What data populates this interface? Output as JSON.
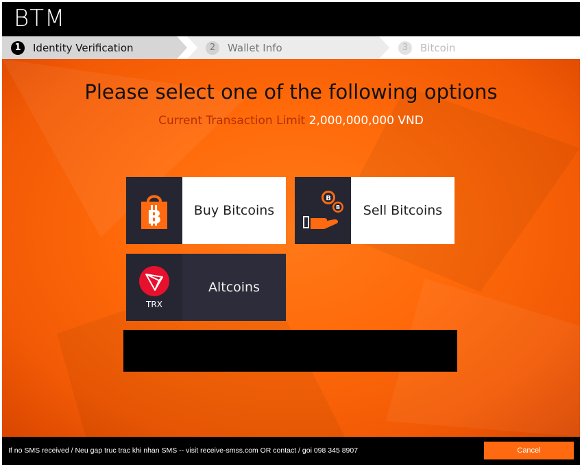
{
  "app": {
    "title": "BTM"
  },
  "steps": [
    {
      "number": "1",
      "label": "Identity Verification",
      "state": "active"
    },
    {
      "number": "2",
      "label": "Wallet Info",
      "state": "pending"
    },
    {
      "number": "3",
      "label": "Bitcoin",
      "state": "pending"
    }
  ],
  "main": {
    "heading": "Please select one of the following options",
    "limit_label": "Current Transaction Limit",
    "limit_value": "2,000,000,000 VND"
  },
  "options": {
    "buy": {
      "label": "Buy Bitcoins",
      "icon": "shopping-bag-bitcoin-icon"
    },
    "sell": {
      "label": "Sell Bitcoins",
      "icon": "hand-coins-icon"
    },
    "altcoins": {
      "label": "Altcoins",
      "icon": "tron-icon",
      "icon_text": "TRX"
    }
  },
  "footer": {
    "note": "If no SMS received / Neu gap truc trac khi nhan SMS -- visit receive-smss.com OR contact / goi 098 345 8907",
    "cancel_label": "Cancel"
  },
  "colors": {
    "accent": "#ff6a10",
    "background": "#ff6a0a",
    "dark": "#262633",
    "limit_label": "#b33000"
  }
}
